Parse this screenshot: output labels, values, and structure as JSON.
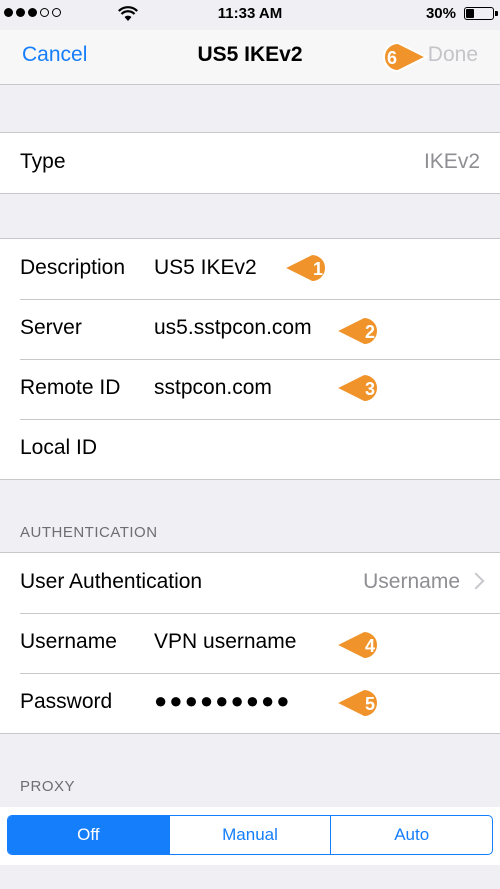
{
  "status_bar": {
    "time": "11:33 AM",
    "battery": "30%",
    "signal_bars_filled": 3,
    "signal_bars_total": 5
  },
  "nav": {
    "cancel_label": "Cancel",
    "title": "US5 IKEv2",
    "done_label": "Done"
  },
  "type_row": {
    "label": "Type",
    "value": "IKEv2"
  },
  "connection": {
    "description_label": "Description",
    "description_value": "US5 IKEv2",
    "server_label": "Server",
    "server_value": "us5.sstpcon.com",
    "remote_id_label": "Remote ID",
    "remote_id_value": "sstpcon.com",
    "local_id_label": "Local ID",
    "local_id_value": ""
  },
  "authentication": {
    "header": "AUTHENTICATION",
    "user_auth_label": "User Authentication",
    "user_auth_value": "Username",
    "username_label": "Username",
    "username_value": "VPN username",
    "password_label": "Password",
    "password_value": "●●●●●●●●●"
  },
  "proxy": {
    "header": "PROXY",
    "options": [
      "Off",
      "Manual",
      "Auto"
    ],
    "selected": "Off"
  },
  "callouts": [
    "1",
    "2",
    "3",
    "4",
    "5",
    "6"
  ],
  "colors": {
    "accent": "#157efb",
    "callout": "#f0932b",
    "background": "#efeff4",
    "disabled": "#c4c4c9"
  }
}
